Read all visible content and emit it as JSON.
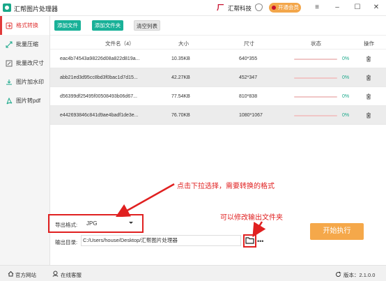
{
  "titlebar": {
    "app_title": "汇帮图片处理器",
    "brand": "汇帮科技",
    "vip_label": "开通会员",
    "menu_icon": "≡",
    "minimize_icon": "–",
    "maximize_icon": "☐",
    "close_icon": "✕"
  },
  "sidebar": {
    "items": [
      {
        "label": "格式转换",
        "icon": "convert-icon"
      },
      {
        "label": "批量压缩",
        "icon": "compress-icon"
      },
      {
        "label": "批量改尺寸",
        "icon": "resize-icon"
      },
      {
        "label": "图片加水印",
        "icon": "watermark-icon"
      },
      {
        "label": "图片转pdf",
        "icon": "pdf-icon"
      }
    ]
  },
  "toolbar": {
    "add_file": "添加文件",
    "add_folder": "添加文件夹",
    "clear_list": "清空列表"
  },
  "table": {
    "headers": {
      "name": "文件名（4）",
      "size": "大小",
      "dimensions": "尺寸",
      "status": "状态",
      "action": "操作"
    },
    "rows": [
      {
        "name": "eac4b74543a98226d08a822d819a...",
        "size": "10.35KB",
        "dimensions": "640*355",
        "percent": "0%"
      },
      {
        "name": "abb21ed3d95cc8bd3f0bac1d7d15...",
        "size": "42.27KB",
        "dimensions": "452*347",
        "percent": "0%"
      },
      {
        "name": "d56399df25495f00508493b06d67...",
        "size": "77.54KB",
        "dimensions": "810*838",
        "percent": "0%"
      },
      {
        "name": "e442693846c841d9ae4badf1de3e...",
        "size": "76.70KB",
        "dimensions": "1080*1067",
        "percent": "0%"
      }
    ]
  },
  "annotations": {
    "format_hint": "点击下拉选择，需要转换的格式",
    "folder_hint": "可以修改输出文件夹"
  },
  "export": {
    "format_label": "导出格式:",
    "format_value": "JPG",
    "dir_label": "输出目录:",
    "dir_value": "C:/Users/house/Desktop/汇帮图片处理器",
    "more": "•••",
    "start_label": "开始执行"
  },
  "footer": {
    "website": "官方网站",
    "support": "在线客服",
    "version": "版本：2.1.0.0"
  },
  "colors": {
    "accent_green": "#19b198",
    "accent_red": "#e02020",
    "accent_orange": "#f5a84a"
  }
}
